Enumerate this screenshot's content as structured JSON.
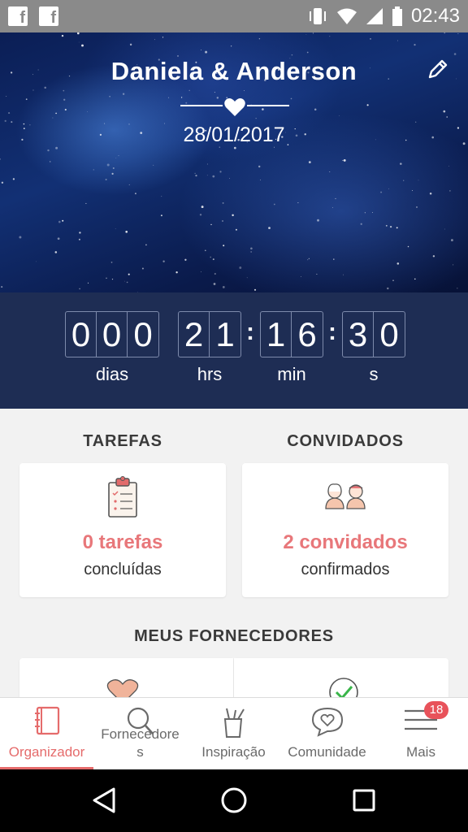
{
  "status_bar": {
    "time": "02:43",
    "icons": [
      "facebook-icon",
      "facebook-icon",
      "vibrate-icon",
      "wifi-icon",
      "signal-icon",
      "battery-icon"
    ]
  },
  "header": {
    "couple": "Daniela & Anderson",
    "date": "28/01/2017"
  },
  "countdown": {
    "days": [
      "0",
      "0",
      "0"
    ],
    "hours": [
      "2",
      "1"
    ],
    "minutes": [
      "1",
      "6"
    ],
    "seconds": [
      "3",
      "0"
    ],
    "labels": {
      "days": "dias",
      "hours": "hrs",
      "minutes": "min",
      "seconds": "s"
    }
  },
  "tarefas": {
    "title": "TAREFAS",
    "count": "0 tarefas",
    "sub": "concluídas"
  },
  "convidados": {
    "title": "CONVIDADOS",
    "count": "2 convidados",
    "sub": "confirmados"
  },
  "fornecedores": {
    "title": "MEUS FORNECEDORES"
  },
  "tabs": [
    {
      "label": "Organizador",
      "icon": "notebook-icon",
      "active": true
    },
    {
      "label_line1": "Fornecedore",
      "label_line2": "s",
      "icon": "search-icon"
    },
    {
      "label": "Inspiração",
      "icon": "pencil-cup-icon"
    },
    {
      "label": "Comunidade",
      "icon": "chat-heart-icon"
    },
    {
      "label": "Mais",
      "icon": "menu-icon",
      "badge": "18"
    }
  ],
  "colors": {
    "accent": "#e56b6b",
    "countdown_bg": "#1e2d54",
    "statusbar": "#8a8a8a"
  }
}
